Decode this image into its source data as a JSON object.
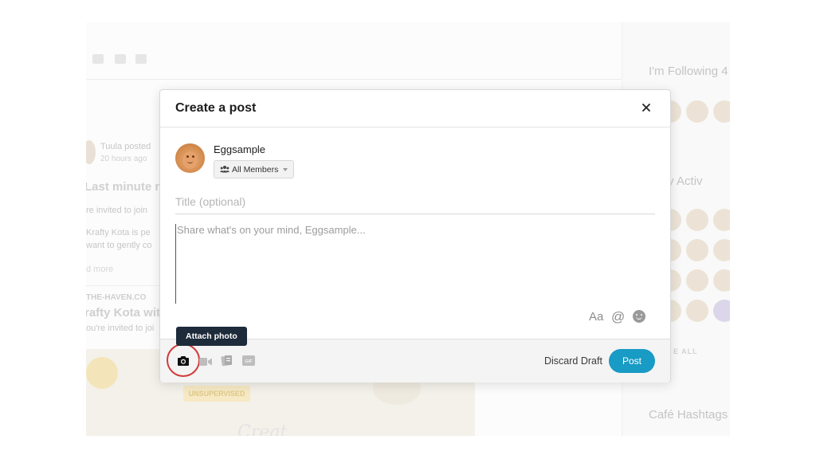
{
  "background": {
    "feed": {
      "poster_name": "Tuula",
      "poster_action": "posted",
      "post_time": "20 hours ago",
      "post_title": "Last minute notic",
      "line1": "re invited to join",
      "line2": "Krafty Kota is pe",
      "line3": "want to gently co",
      "read_more": "d more",
      "source": "THE-HAVEN.CO",
      "link_title": "rafty Kota with",
      "link_desc": "ou're invited to joi",
      "image_badge": "UNSUPERVISED",
      "image_script": "Creat"
    },
    "sidebar": {
      "following_heading": "I'm Following 4",
      "recent_heading": "ently Activ",
      "see_all": "E ALL",
      "hashtags_heading": "Café Hashtags"
    }
  },
  "modal": {
    "title": "Create a post",
    "close_icon": "close-icon",
    "author": {
      "name": "Eggsample",
      "avatar_icon": "egg-avatar"
    },
    "audience": {
      "label": "All Members",
      "icon": "group-icon"
    },
    "title_placeholder": "Title (optional)",
    "body_placeholder": "Share what's on your mind, Eggsample...",
    "formatting": {
      "text_format_label": "Aa",
      "mention_label": "@",
      "emoji_icon": "emoji-icon"
    },
    "tooltip": "Attach photo",
    "attachments": [
      {
        "name": "camera-icon",
        "label": "Attach photo"
      },
      {
        "name": "video-icon"
      },
      {
        "name": "document-icon"
      },
      {
        "name": "gif-icon",
        "label": "GIF"
      }
    ],
    "discard_label": "Discard Draft",
    "post_label": "Post",
    "colors": {
      "accent": "#189bc4",
      "tooltip_bg": "#1d2b3a",
      "highlight": "#d23a3a"
    }
  }
}
